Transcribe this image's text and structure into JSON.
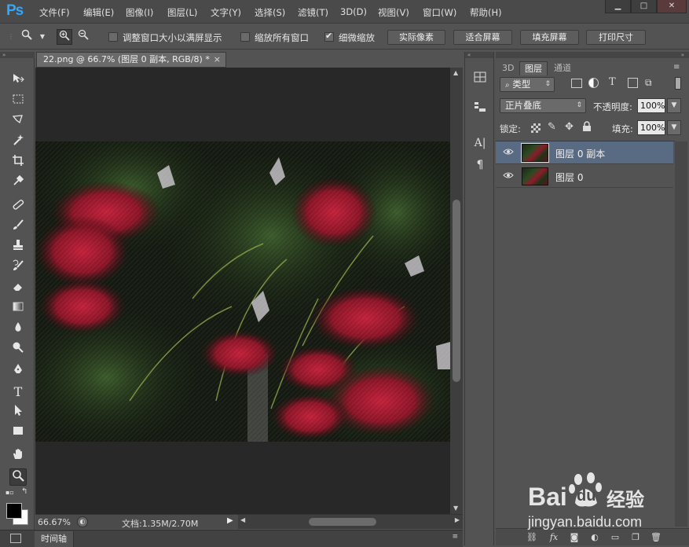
{
  "app": {
    "logo": "Ps",
    "menus": [
      "文件(F)",
      "编辑(E)",
      "图像(I)",
      "图层(L)",
      "文字(Y)",
      "选择(S)",
      "滤镜(T)",
      "3D(D)",
      "视图(V)",
      "窗口(W)",
      "帮助(H)"
    ],
    "window_buttons": [
      "▁",
      "□",
      "✕"
    ]
  },
  "options": {
    "checkbox1": {
      "label": "调整窗口大小以满屏显示",
      "checked": false
    },
    "checkbox2": {
      "label": "缩放所有窗口",
      "checked": false
    },
    "checkbox3": {
      "label": "细微缩放",
      "checked": true
    },
    "buttons": [
      "实际像素",
      "适合屏幕",
      "填充屏幕",
      "打印尺寸"
    ]
  },
  "document": {
    "tab_title": "22.png @ 66.7% (图层 0 副本, RGB/8) *",
    "close": "×",
    "zoom": "66.67%",
    "doc_info": "文档:1.35M/2.70M",
    "timeline": "时间轴"
  },
  "layers_panel": {
    "tabs": [
      "3D",
      "图层",
      "通道"
    ],
    "active_tab": "图层",
    "filter_kind": "类型",
    "blend_mode": "正片叠底",
    "opacity_label": "不透明度:",
    "opacity_value": "100%",
    "lock_label": "锁定:",
    "fill_label": "填充:",
    "fill_value": "100%",
    "layers": [
      {
        "name": "图层 0 副本",
        "selected": true
      },
      {
        "name": "图层 0",
        "selected": false
      }
    ]
  },
  "watermark": {
    "brand_latin": "Bai",
    "brand_latin2": "du",
    "brand_cn": "经验",
    "url": "jingyan.baidu.com"
  },
  "colors": {
    "accent": "#31a8ff",
    "selected_layer": "#596a83",
    "panel_bg": "#535353",
    "canvas_bg": "#282828"
  }
}
